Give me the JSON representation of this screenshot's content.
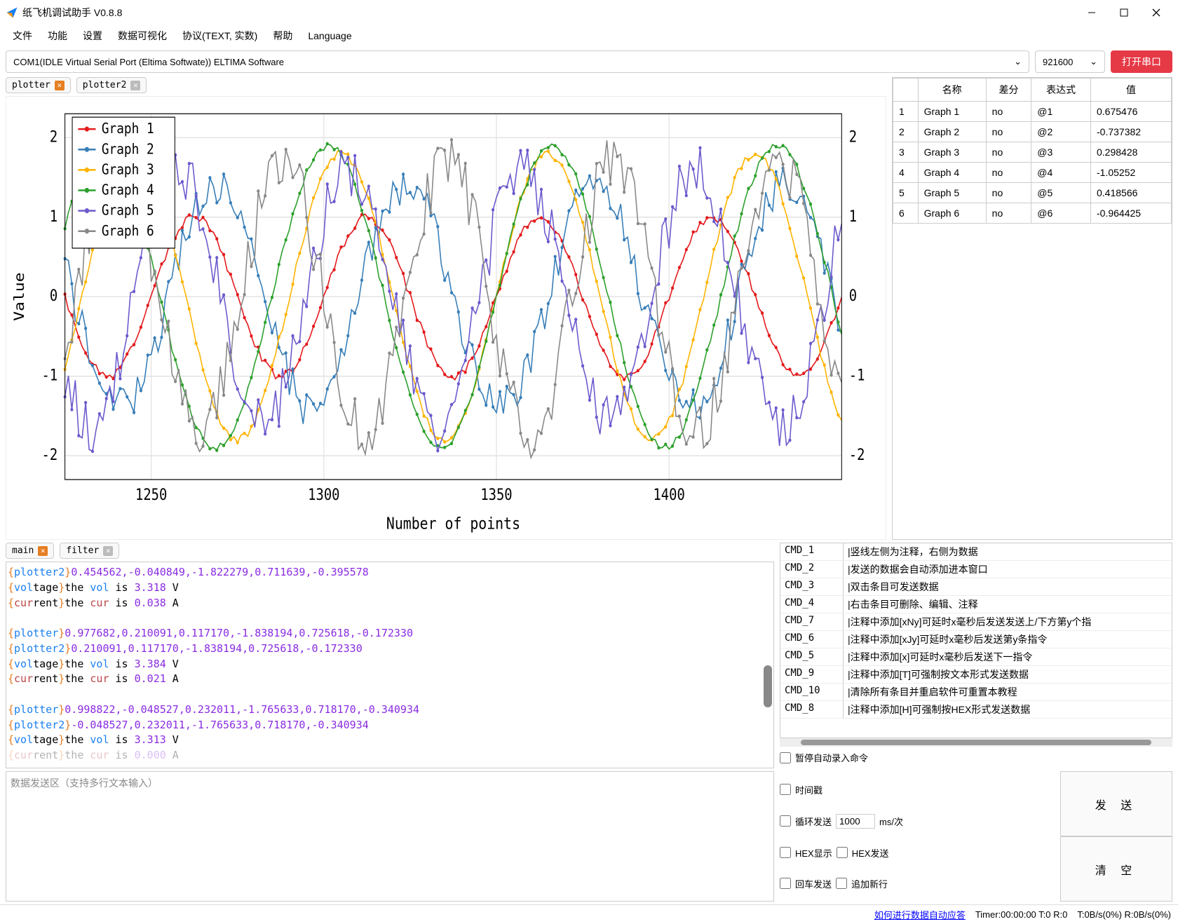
{
  "window": {
    "title": "纸飞机调试助手 V0.8.8"
  },
  "menu": [
    "文件",
    "功能",
    "设置",
    "数据可视化",
    "协议(TEXT, 实数)",
    "帮助",
    "Language"
  ],
  "conn": {
    "port": "COM1(IDLE  Virtual Serial Port (Eltima Softwate)) ELTIMA Software",
    "baud": "921600",
    "open": "打开串口"
  },
  "plot_tabs": [
    {
      "label": "plotter",
      "close": "red"
    },
    {
      "label": "plotter2",
      "close": "gray"
    }
  ],
  "chart_data": {
    "type": "line",
    "xlabel": "Number of points",
    "ylabel": "Value",
    "xlim": [
      1225,
      1450
    ],
    "ylim": [
      -2.3,
      2.3
    ],
    "xticks": [
      1250,
      1300,
      1350,
      1400
    ],
    "yticks": [
      -2,
      -1,
      0,
      1,
      2
    ],
    "legend_position": "top-left",
    "series": [
      {
        "name": "Graph 1",
        "color": "#e41a1c",
        "amplitude": 1.0,
        "period": 50,
        "phase": 0,
        "noise": 0.05
      },
      {
        "name": "Graph 2",
        "color": "#377eb8",
        "amplitude": 1.4,
        "period": 55,
        "phase": 10,
        "noise": 0.25
      },
      {
        "name": "Graph 3",
        "color": "#ffb300",
        "amplitude": 1.8,
        "period": 60,
        "phase": 30,
        "noise": 0.05
      },
      {
        "name": "Graph 4",
        "color": "#2ca02c",
        "amplitude": 1.9,
        "period": 65,
        "phase": 15,
        "noise": 0.05
      },
      {
        "name": "Graph 5",
        "color": "#6a5acd",
        "amplitude": 1.6,
        "period": 50,
        "phase": 5,
        "noise": 0.35
      },
      {
        "name": "Graph 6",
        "color": "#888888",
        "amplitude": 1.7,
        "period": 48,
        "phase": 20,
        "noise": 0.35
      }
    ]
  },
  "datatable": {
    "headers": [
      "",
      "名称",
      "差分",
      "表达式",
      "值"
    ],
    "rows": [
      [
        "1",
        "Graph 1",
        "no",
        "@1",
        "0.675476"
      ],
      [
        "2",
        "Graph 2",
        "no",
        "@2",
        "-0.737382"
      ],
      [
        "3",
        "Graph 3",
        "no",
        "@3",
        "0.298428"
      ],
      [
        "4",
        "Graph 4",
        "no",
        "@4",
        "-1.05252"
      ],
      [
        "5",
        "Graph 5",
        "no",
        "@5",
        "0.418566"
      ],
      [
        "6",
        "Graph 6",
        "no",
        "@6",
        "-0.964425"
      ]
    ]
  },
  "log_tabs": [
    {
      "label": "main",
      "close": "red"
    },
    {
      "label": "filter",
      "close": "gray"
    }
  ],
  "log_lines": [
    {
      "type": "plotter2",
      "vals": "0.454562,-0.040849,-1.822279,0.711639,-0.395578"
    },
    {
      "type": "voltage",
      "text_pre": "the ",
      "kw": "vol",
      "text_mid": " is ",
      "val": "3.318",
      "unit": " V"
    },
    {
      "type": "current",
      "text_pre": "the ",
      "kw": "cur",
      "text_mid": " is ",
      "val": "0.038",
      "unit": " A"
    },
    {
      "blank": true
    },
    {
      "type": "plotter",
      "vals": "0.977682,0.210091,0.117170,-1.838194,0.725618,-0.172330"
    },
    {
      "type": "plotter2",
      "vals": "0.210091,0.117170,-1.838194,0.725618,-0.172330"
    },
    {
      "type": "voltage",
      "text_pre": "the ",
      "kw": "vol",
      "text_mid": " is ",
      "val": "3.384",
      "unit": " V"
    },
    {
      "type": "current",
      "text_pre": "the ",
      "kw": "cur",
      "text_mid": " is ",
      "val": "0.021",
      "unit": " A"
    },
    {
      "blank": true
    },
    {
      "type": "plotter",
      "vals": "0.998822,-0.048527,0.232011,-1.765633,0.718170,-0.340934"
    },
    {
      "type": "plotter2",
      "vals": "-0.048527,0.232011,-1.765633,0.718170,-0.340934"
    },
    {
      "type": "voltage",
      "text_pre": "the ",
      "kw": "vol",
      "text_mid": " is ",
      "val": "3.313",
      "unit": " V"
    },
    {
      "type": "current",
      "text_pre": "the ",
      "kw": "cur",
      "text_mid": " is ",
      "val": "0.000",
      "unit": " A",
      "faded": true
    }
  ],
  "cmds": [
    {
      "n": "CMD_1",
      "d": "|竖线左侧为注释，右侧为数据"
    },
    {
      "n": "CMD_2",
      "d": "|发送的数据会自动添加进本窗口"
    },
    {
      "n": "CMD_3",
      "d": "|双击条目可发送数据"
    },
    {
      "n": "CMD_4",
      "d": "|右击条目可删除、编辑、注释"
    },
    {
      "n": "CMD_7",
      "d": "|注释中添加[xNy]可延时x毫秒后发送发送上/下方第y个指"
    },
    {
      "n": "CMD_6",
      "d": "|注释中添加[xJy]可延时x毫秒后发送第y条指令"
    },
    {
      "n": "CMD_5",
      "d": "|注释中添加[x]可延时x毫秒后发送下一指令"
    },
    {
      "n": "CMD_9",
      "d": "|注释中添加[T]可强制按文本形式发送数据"
    },
    {
      "n": "CMD_10",
      "d": "|清除所有条目并重启软件可重置本教程"
    },
    {
      "n": "CMD_8",
      "d": "|注释中添加[H]可强制按HEX形式发送数据"
    }
  ],
  "pause_label": "暂停自动录入命令",
  "send": {
    "placeholder": "数据发送区（支持多行文本输入）",
    "timestamp": "时间戳",
    "loop": "循环发送",
    "loop_val": "1000",
    "loop_unit": "ms/次",
    "hex_show": "HEX显示",
    "hex_send": "HEX发送",
    "enter_send": "回车发送",
    "append_nl": "追加新行",
    "btn_send": "发 送",
    "btn_clear": "清 空"
  },
  "status": {
    "link": "如何进行数据自动应答",
    "timer": "Timer:00:00:00 T:0 R:0",
    "rate": "T:0B/s(0%) R:0B/s(0%)"
  }
}
